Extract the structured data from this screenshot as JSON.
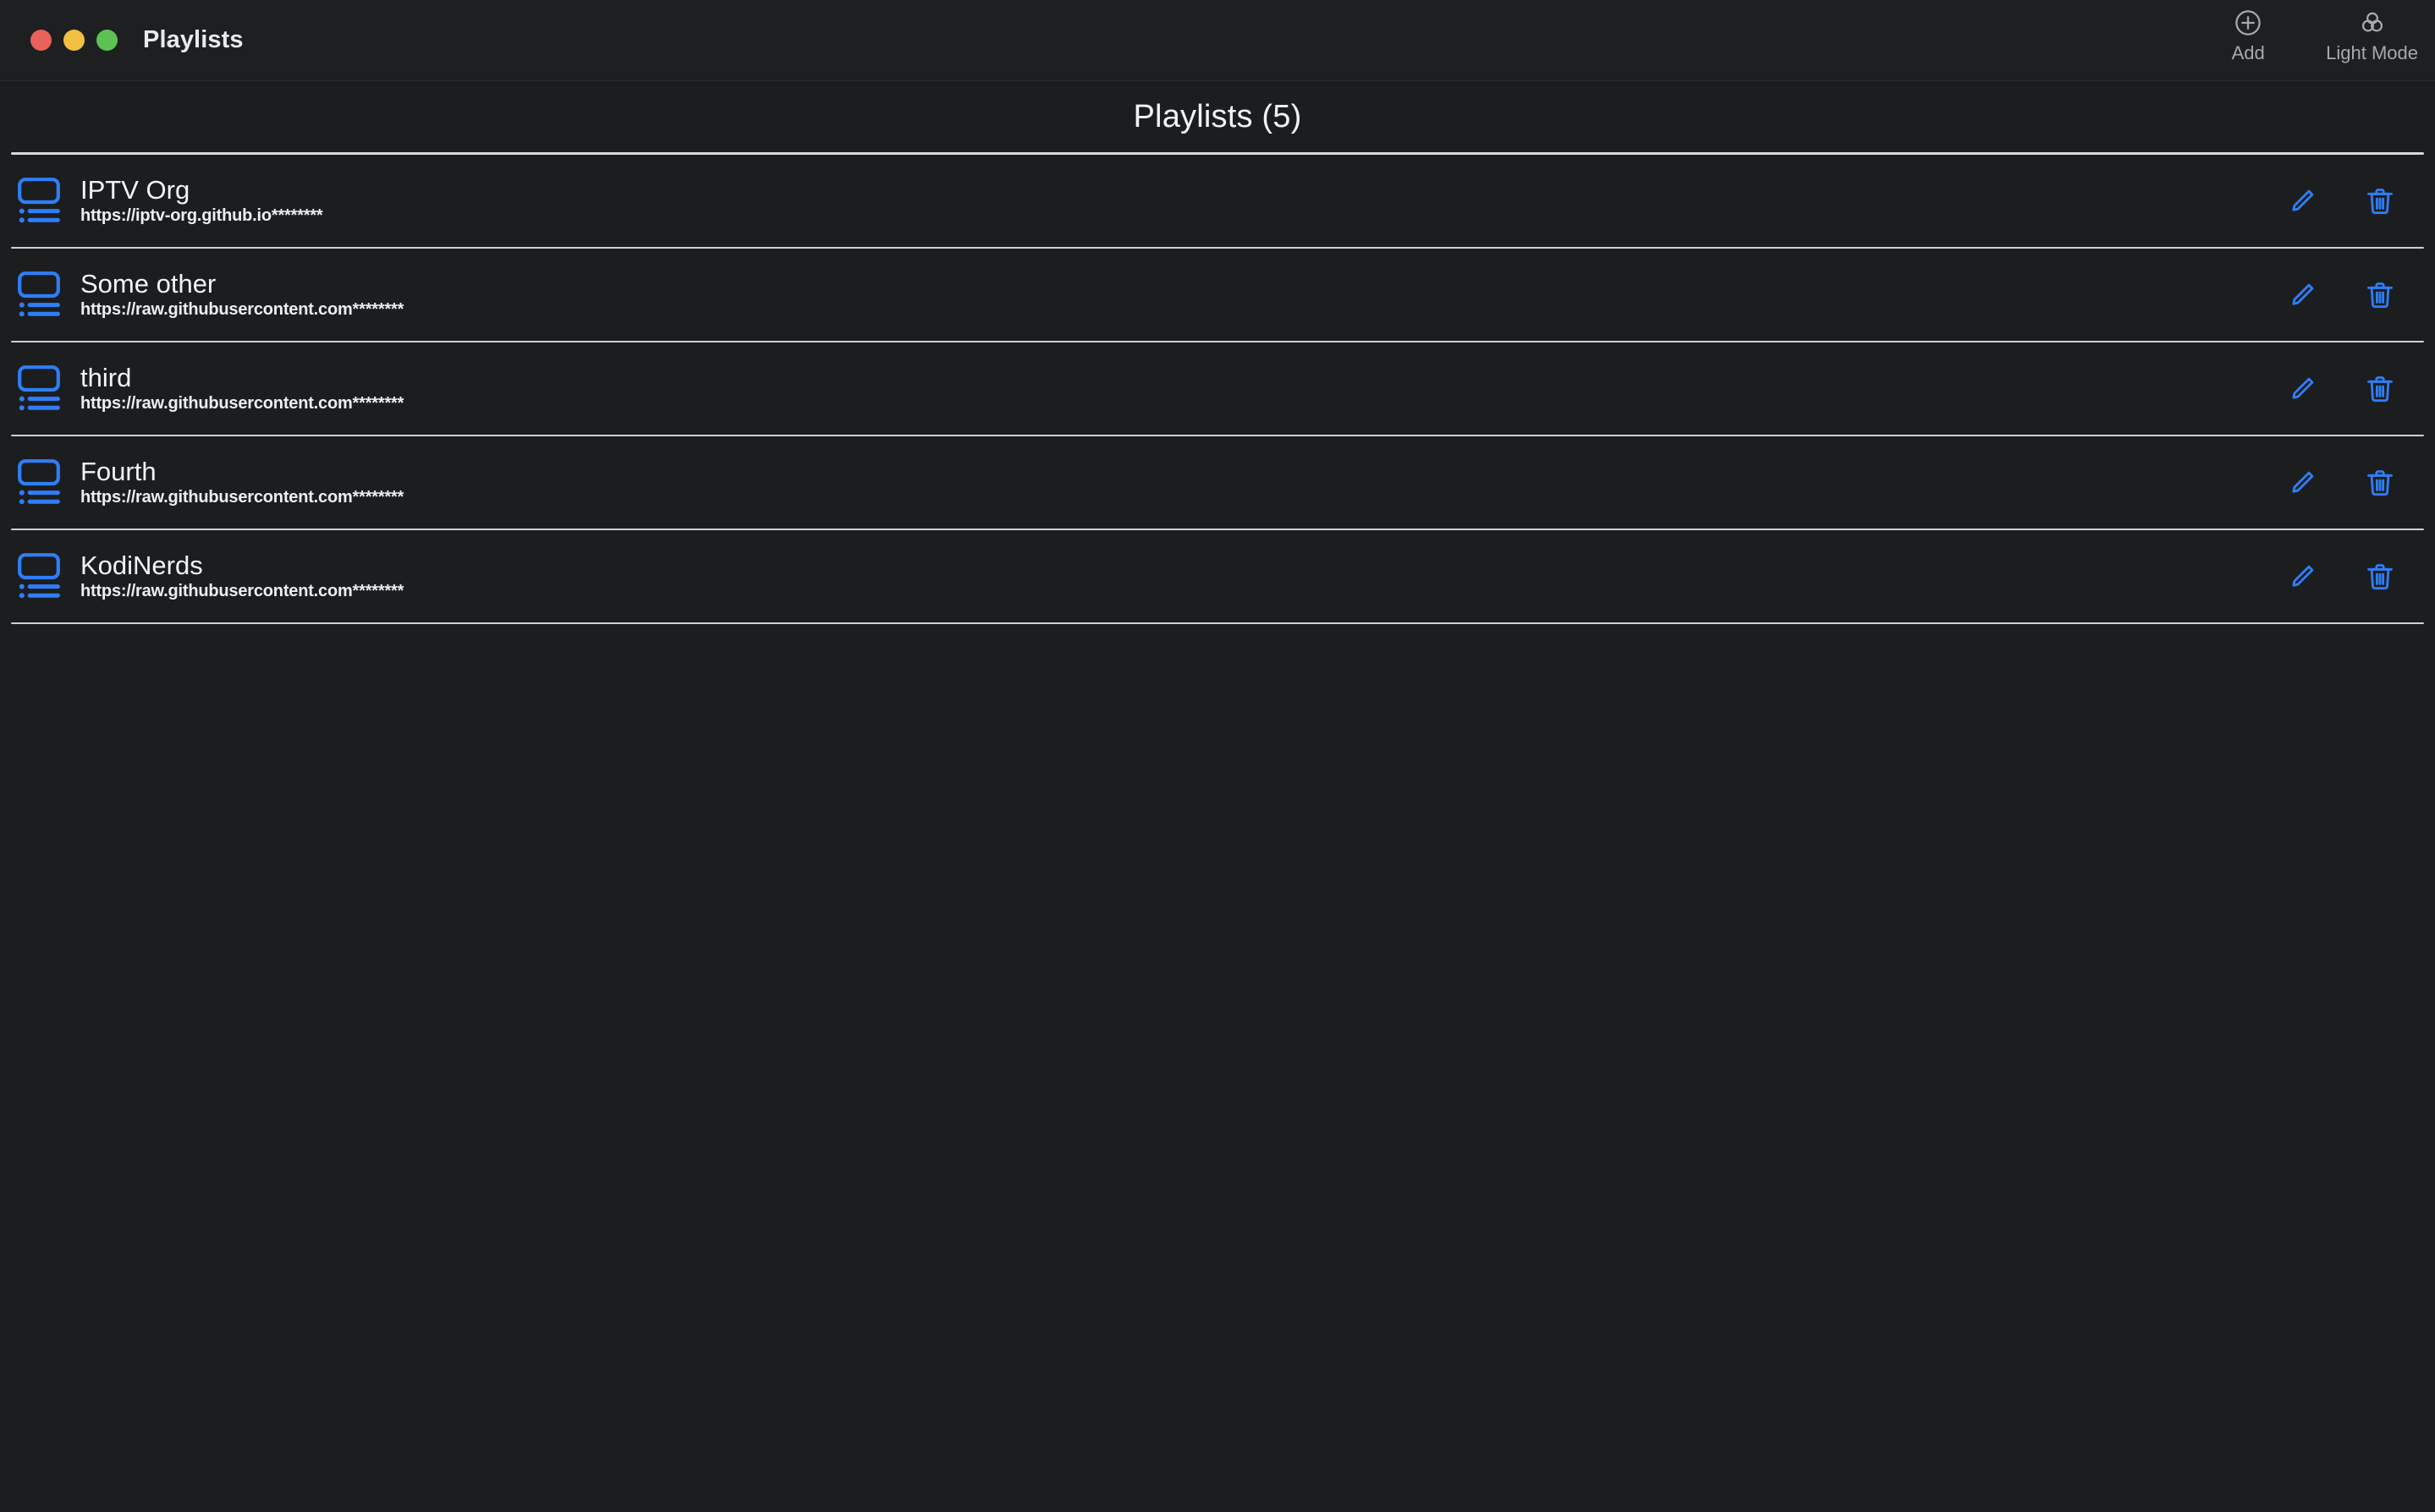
{
  "window": {
    "title": "Playlists",
    "traffic_lights": [
      {
        "name": "close",
        "color": "#e8625a"
      },
      {
        "name": "minimize",
        "color": "#f1bf42"
      },
      {
        "name": "zoom",
        "color": "#5cc353"
      }
    ]
  },
  "toolbar": {
    "buttons": [
      {
        "label": "Add",
        "icon": "plus-circle-icon"
      },
      {
        "label": "Light Mode",
        "icon": "color-palette-icon"
      }
    ]
  },
  "header": {
    "title": "Playlists (5)"
  },
  "colors": {
    "accent_blue": "#2f7ef7",
    "background": "#1c1d1f",
    "titlebar": "#1e1f21",
    "divider": "#d8d9dd",
    "text_primary": "#f3f4f6",
    "toolbar_label": "#a8a9ab"
  },
  "row_actions": {
    "edit_label": "Edit",
    "delete_label": "Delete",
    "edit_icon": "pencil-icon",
    "delete_icon": "trash-icon"
  },
  "playlists": [
    {
      "name": "IPTV Org",
      "url": "https://iptv-org.github.io********",
      "icon": "playlist-tv-icon"
    },
    {
      "name": "Some other",
      "url": "https://raw.githubusercontent.com********",
      "icon": "playlist-tv-icon"
    },
    {
      "name": "third",
      "url": "https://raw.githubusercontent.com********",
      "icon": "playlist-tv-icon"
    },
    {
      "name": "Fourth",
      "url": "https://raw.githubusercontent.com********",
      "icon": "playlist-tv-icon"
    },
    {
      "name": "KodiNerds",
      "url": "https://raw.githubusercontent.com********",
      "icon": "playlist-tv-icon"
    }
  ]
}
